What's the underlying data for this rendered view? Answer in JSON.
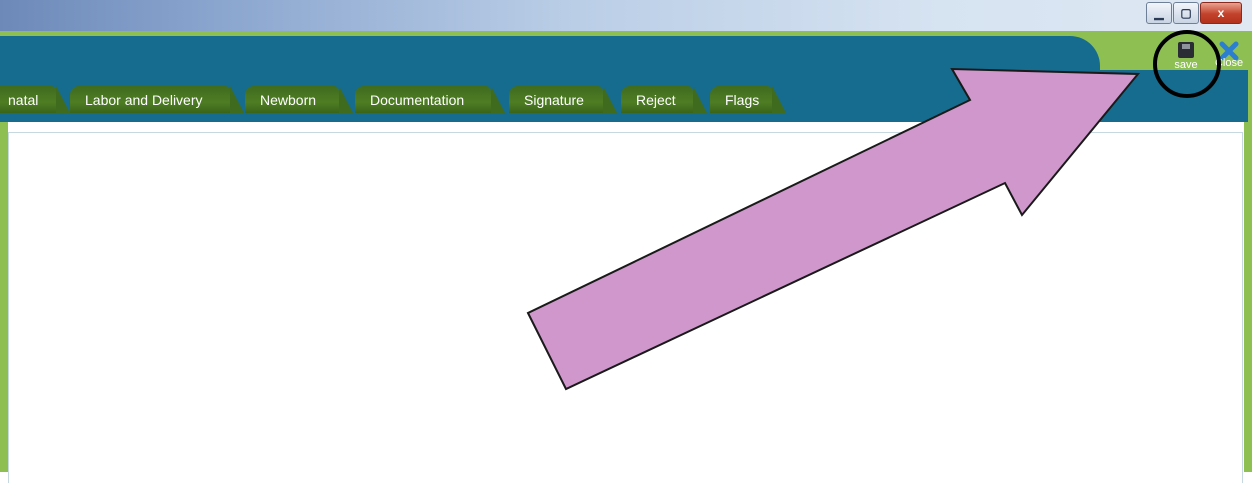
{
  "window": {
    "controls": {
      "minimize_icon": "minimize-icon",
      "restore_icon": "restore-icon",
      "close_label": "x"
    }
  },
  "tabs": [
    {
      "label": "natal",
      "partial": true
    },
    {
      "label": "Labor and Delivery"
    },
    {
      "label": "Newborn"
    },
    {
      "label": "Documentation"
    },
    {
      "label": "Signature"
    },
    {
      "label": "Reject"
    },
    {
      "label": "Flags"
    }
  ],
  "toolbar": {
    "save_label": "save",
    "save_icon": "save-icon",
    "close_label": "Close",
    "close_icon": "close-icon"
  },
  "annotation": {
    "arrow_color": "#cf97cc",
    "circle_color": "#000000"
  },
  "colors": {
    "header_teal": "#166c8e",
    "frame_green": "#8dbf52",
    "tab_green": "#3f6b1e"
  }
}
